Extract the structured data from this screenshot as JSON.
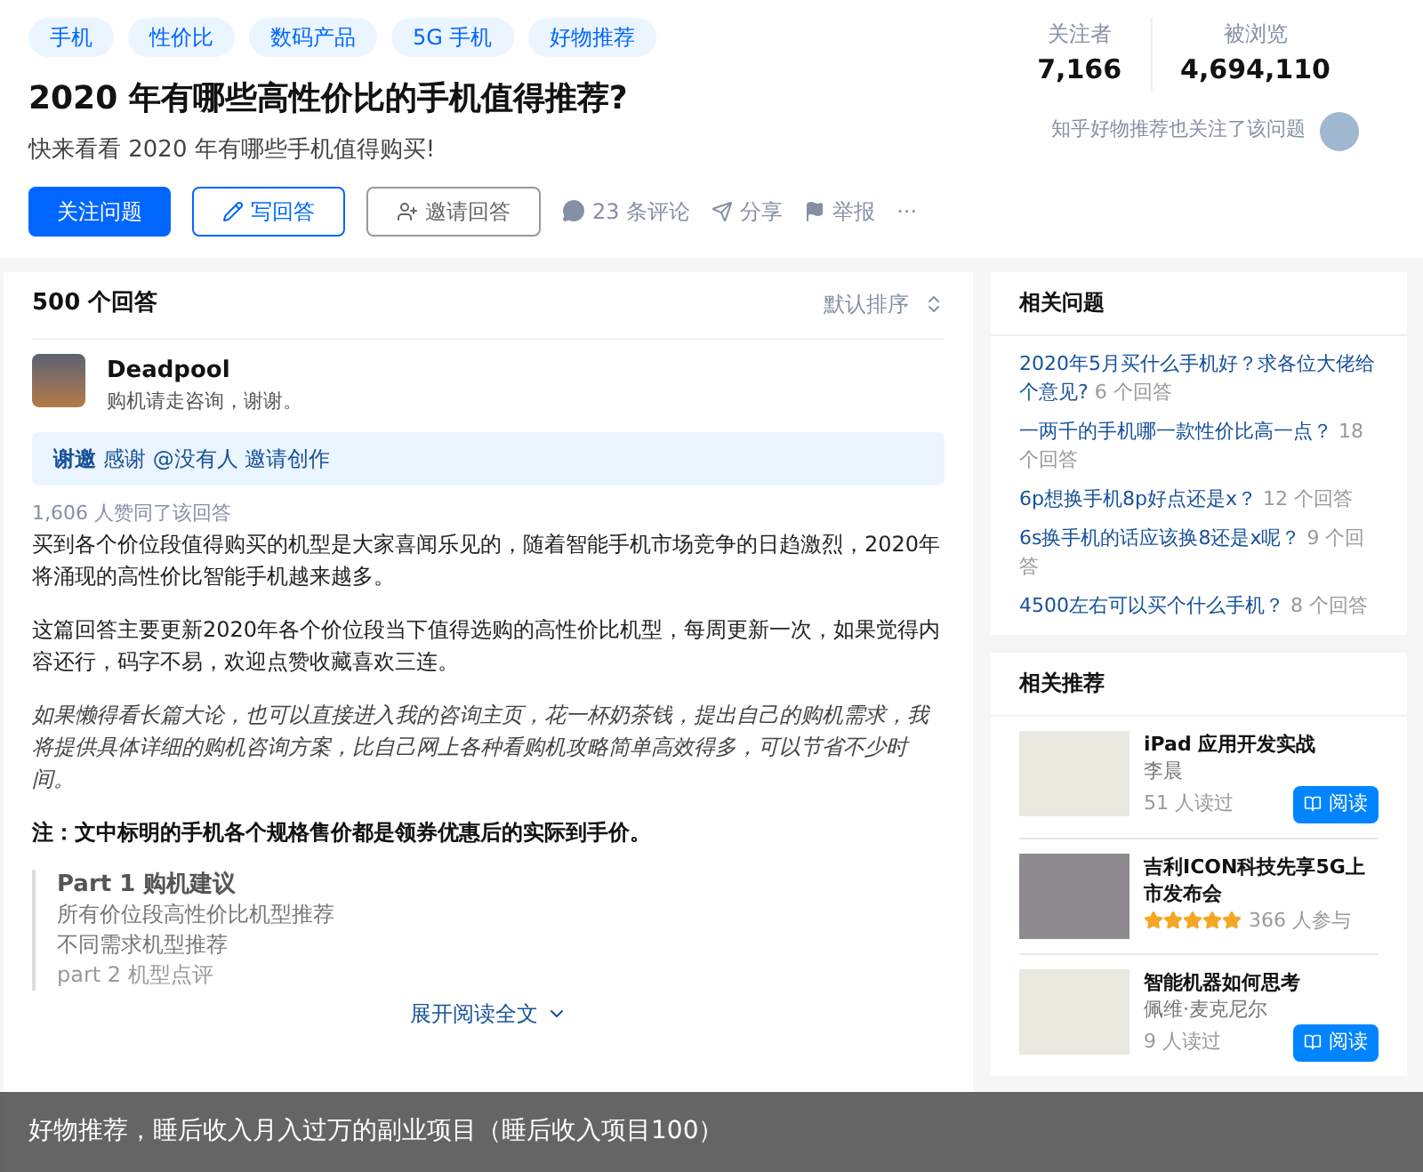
{
  "topics": [
    "手机",
    "性价比",
    "数码产品",
    "5G 手机",
    "好物推荐"
  ],
  "question": {
    "title": "2020 年有哪些高性价比的手机值得推荐?",
    "detail": "快来看看 2020 年有哪些手机值得购买!"
  },
  "stats": [
    {
      "label": "关注者",
      "value": "7,166"
    },
    {
      "label": "被浏览",
      "value": "4,694,110"
    }
  ],
  "follower_note": "知乎好物推荐也关注了该问题",
  "actions": {
    "follow": "关注问题",
    "write": "写回答",
    "invite": "邀请回答",
    "comments": "23 条评论",
    "share": "分享",
    "report": "举报",
    "more": "···"
  },
  "answers": {
    "count": "500 个回答",
    "sort": "默认排序",
    "author": {
      "name": "Deadpool",
      "bio": "购机请走咨询，谢谢。"
    },
    "thanks": {
      "tag": "谢邀",
      "text": "感谢 @没有人 邀请创作"
    },
    "votes": "1,606 人赞同了该回答",
    "paragraphs": [
      {
        "kind": "normal",
        "text": "买到各个价位段值得购买的机型是大家喜闻乐见的，随着智能手机市场竞争的日趋激烈，2020年将涌现的高性价比智能手机越来越多。"
      },
      {
        "kind": "normal",
        "text": "这篇回答主要更新2020年各个价位段当下值得选购的高性价比机型，每周更新一次，如果觉得内容还行，码字不易，欢迎点赞收藏喜欢三连。"
      },
      {
        "kind": "italic",
        "text": "如果懒得看长篇大论，也可以直接进入我的咨询主页，花一杯奶茶钱，提出自己的购机需求，我将提供具体详细的购机咨询方案，比自己网上各种看购机攻略简单高效得多，可以节省不少时间。"
      },
      {
        "kind": "bold",
        "text": "注：文中标明的手机各个规格售价都是领券优惠后的实际到手价。"
      }
    ],
    "quote": [
      {
        "kind": "heading",
        "text": "Part 1 购机建议"
      },
      {
        "kind": "line",
        "text": "所有价位段高性价比机型推荐"
      },
      {
        "kind": "line",
        "text": "不同需求机型推荐"
      },
      {
        "kind": "fade",
        "text": "part 2 机型点评"
      }
    ],
    "expand": "展开阅读全文"
  },
  "related_questions": {
    "title": "相关问题",
    "items": [
      {
        "question": "2020年5月买什么手机好？求各位大佬给个意见?",
        "answers": "6 个回答"
      },
      {
        "question": "一两千的手机哪一款性价比高一点？",
        "answers": "18 个回答"
      },
      {
        "question": "6p想换手机8p好点还是x？",
        "answers": "12 个回答"
      },
      {
        "question": "6s换手机的话应该换8还是x呢？",
        "answers": "9 个回答"
      },
      {
        "question": "4500左右可以买个什么手机？",
        "answers": "8 个回答"
      }
    ]
  },
  "recommendations": {
    "title": "相关推荐",
    "items": [
      {
        "kind": "book",
        "title": "iPad 应用开发实战",
        "author": "李晨",
        "reads": "51 人读过",
        "button": "阅读"
      },
      {
        "kind": "live",
        "title": "吉利ICON科技先享5G上市发布会",
        "stars": 5,
        "reads": "366 人参与"
      },
      {
        "kind": "book",
        "title": "智能机器如何思考",
        "author": "佩维·麦克尼尔",
        "reads": "9 人读过",
        "button": "阅读"
      }
    ]
  },
  "caption": "好物推荐，睡后收入月入过万的副业项目（睡后收入项目100）"
}
